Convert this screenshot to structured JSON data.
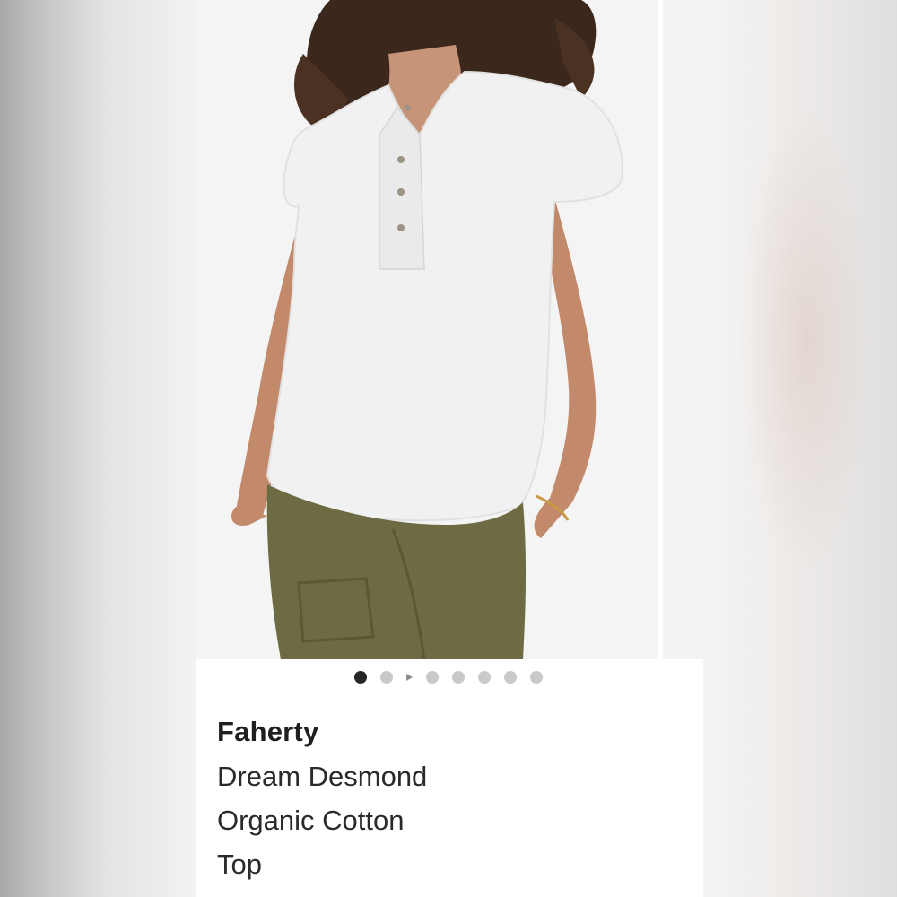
{
  "colors": {
    "card_background": "#ffffff",
    "active_dot": "#262626",
    "inactive_dot": "#c9c9c9",
    "shirt": "#f1f1f1",
    "pants": "#6c6b43",
    "skin": "#c89477",
    "hair": "#3b271c"
  },
  "carousel": {
    "image_count": 7,
    "active_index": 0,
    "play_icon": "play-icon"
  },
  "product": {
    "brand": "Faherty",
    "name_lines": [
      "Dream Desmond",
      "Organic Cotton",
      "Top"
    ]
  }
}
